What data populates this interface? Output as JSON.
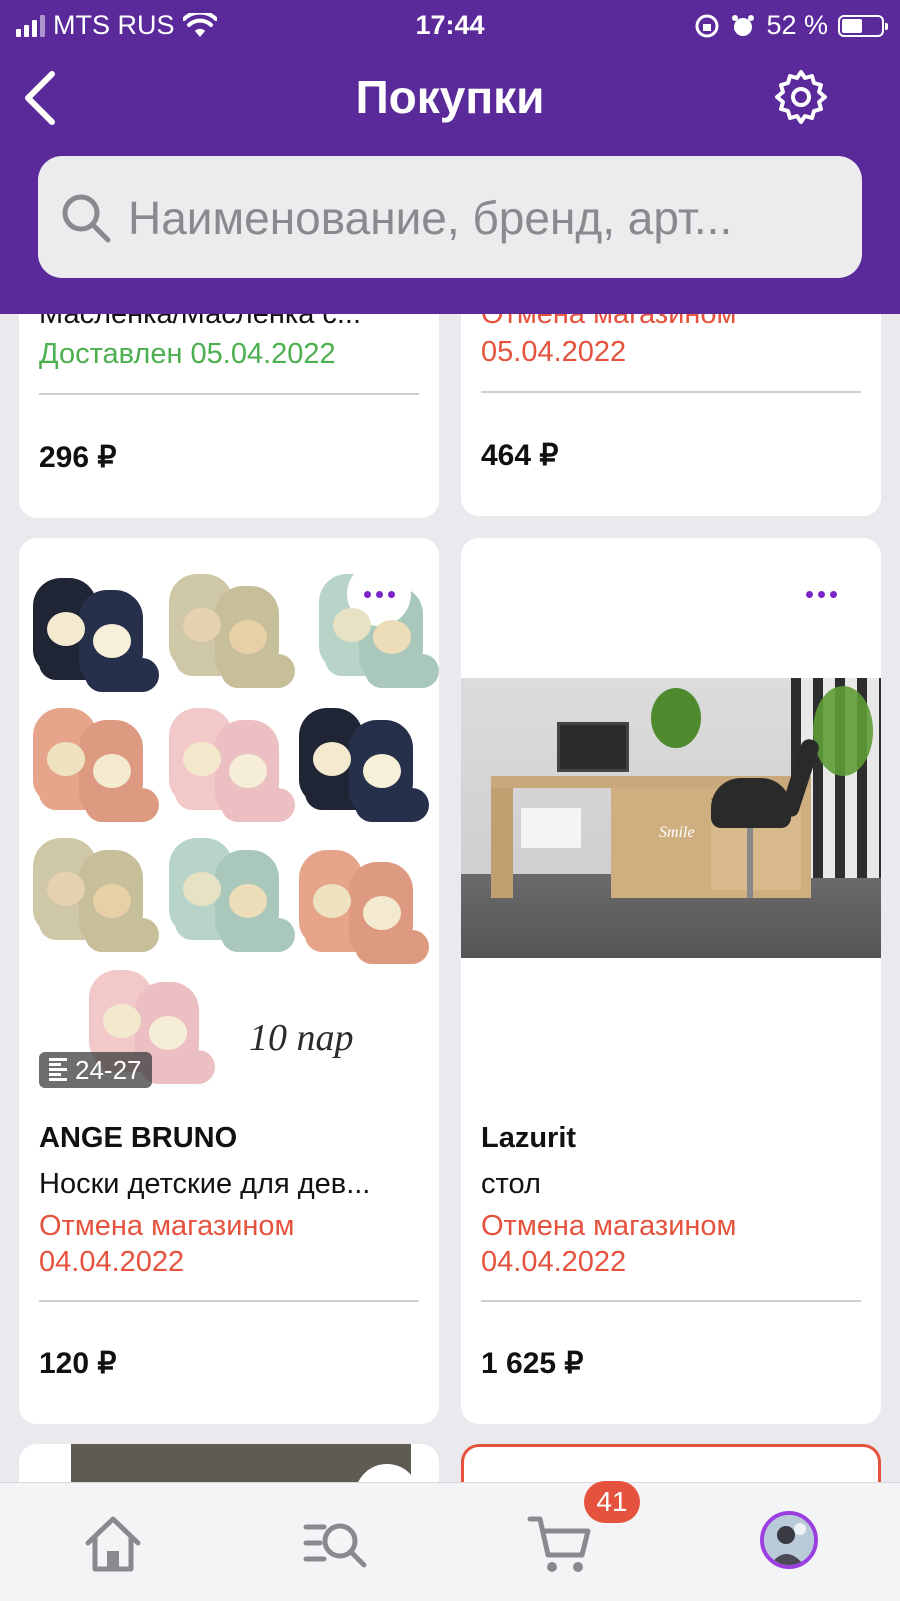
{
  "status_bar": {
    "carrier": "MTS RUS",
    "time": "17:44",
    "battery": "52 %",
    "battery_level": 0.52
  },
  "header": {
    "title": "Покупки"
  },
  "search": {
    "placeholder": "Наименование, бренд, арт..."
  },
  "top_cards": [
    {
      "name": "Масленка/Масленка с...",
      "status": "Доставлен 05.04.2022",
      "price": "296 ₽"
    },
    {
      "status_line1": "Отмена магазином",
      "status_line2": "05.04.2022",
      "price": "464 ₽"
    }
  ],
  "products": [
    {
      "brand": "ANGE BRUNO",
      "name": "Носки детские для дев...",
      "status_line1": "Отмена магазином",
      "status_line2": "04.04.2022",
      "price": "120 ₽",
      "size_badge": "24-27",
      "image_caption": "10 пар"
    },
    {
      "brand": "Lazurit",
      "name": "стол",
      "status_line1": "Отмена магазином",
      "status_line2": "04.04.2022",
      "price": "1 625 ₽",
      "image_caption": "Smile"
    }
  ],
  "tabbar": {
    "cart_count": "41"
  },
  "colors": {
    "brand_purple": "#5a2a9a",
    "accent_purple": "#7b25c9",
    "cancel_red": "#e5533e",
    "delivered_green": "#4caf50"
  }
}
